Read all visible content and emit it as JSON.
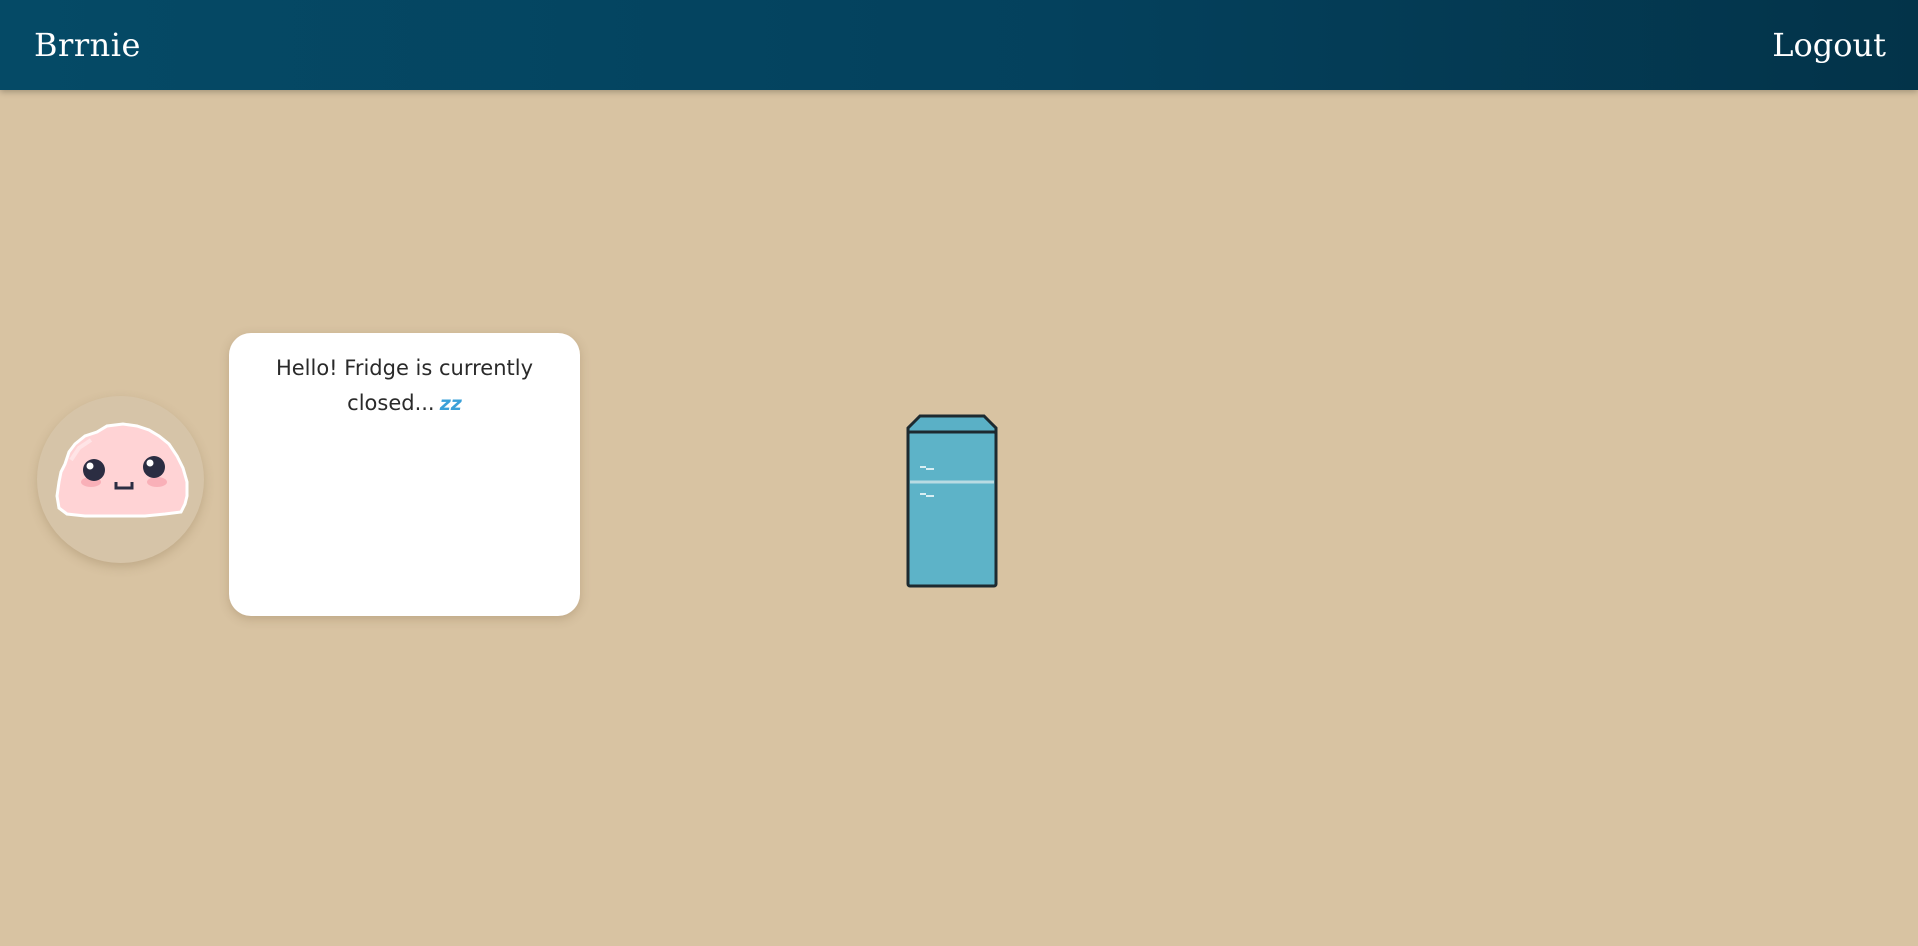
{
  "navbar": {
    "brand": "Brrnie",
    "logout_label": "Logout"
  },
  "assistant": {
    "message": "Hello! Fridge is currently closed...",
    "sleep_icon": "zzz-sleep-icon",
    "sleep_glyph": "zz"
  },
  "fridge": {
    "icon": "fridge-icon",
    "state": "closed"
  },
  "colors": {
    "navbar": "#054a66",
    "background": "#d8c3a2",
    "fridge_body": "#5db3c8",
    "avatar_pink": "#ffd5d7"
  }
}
